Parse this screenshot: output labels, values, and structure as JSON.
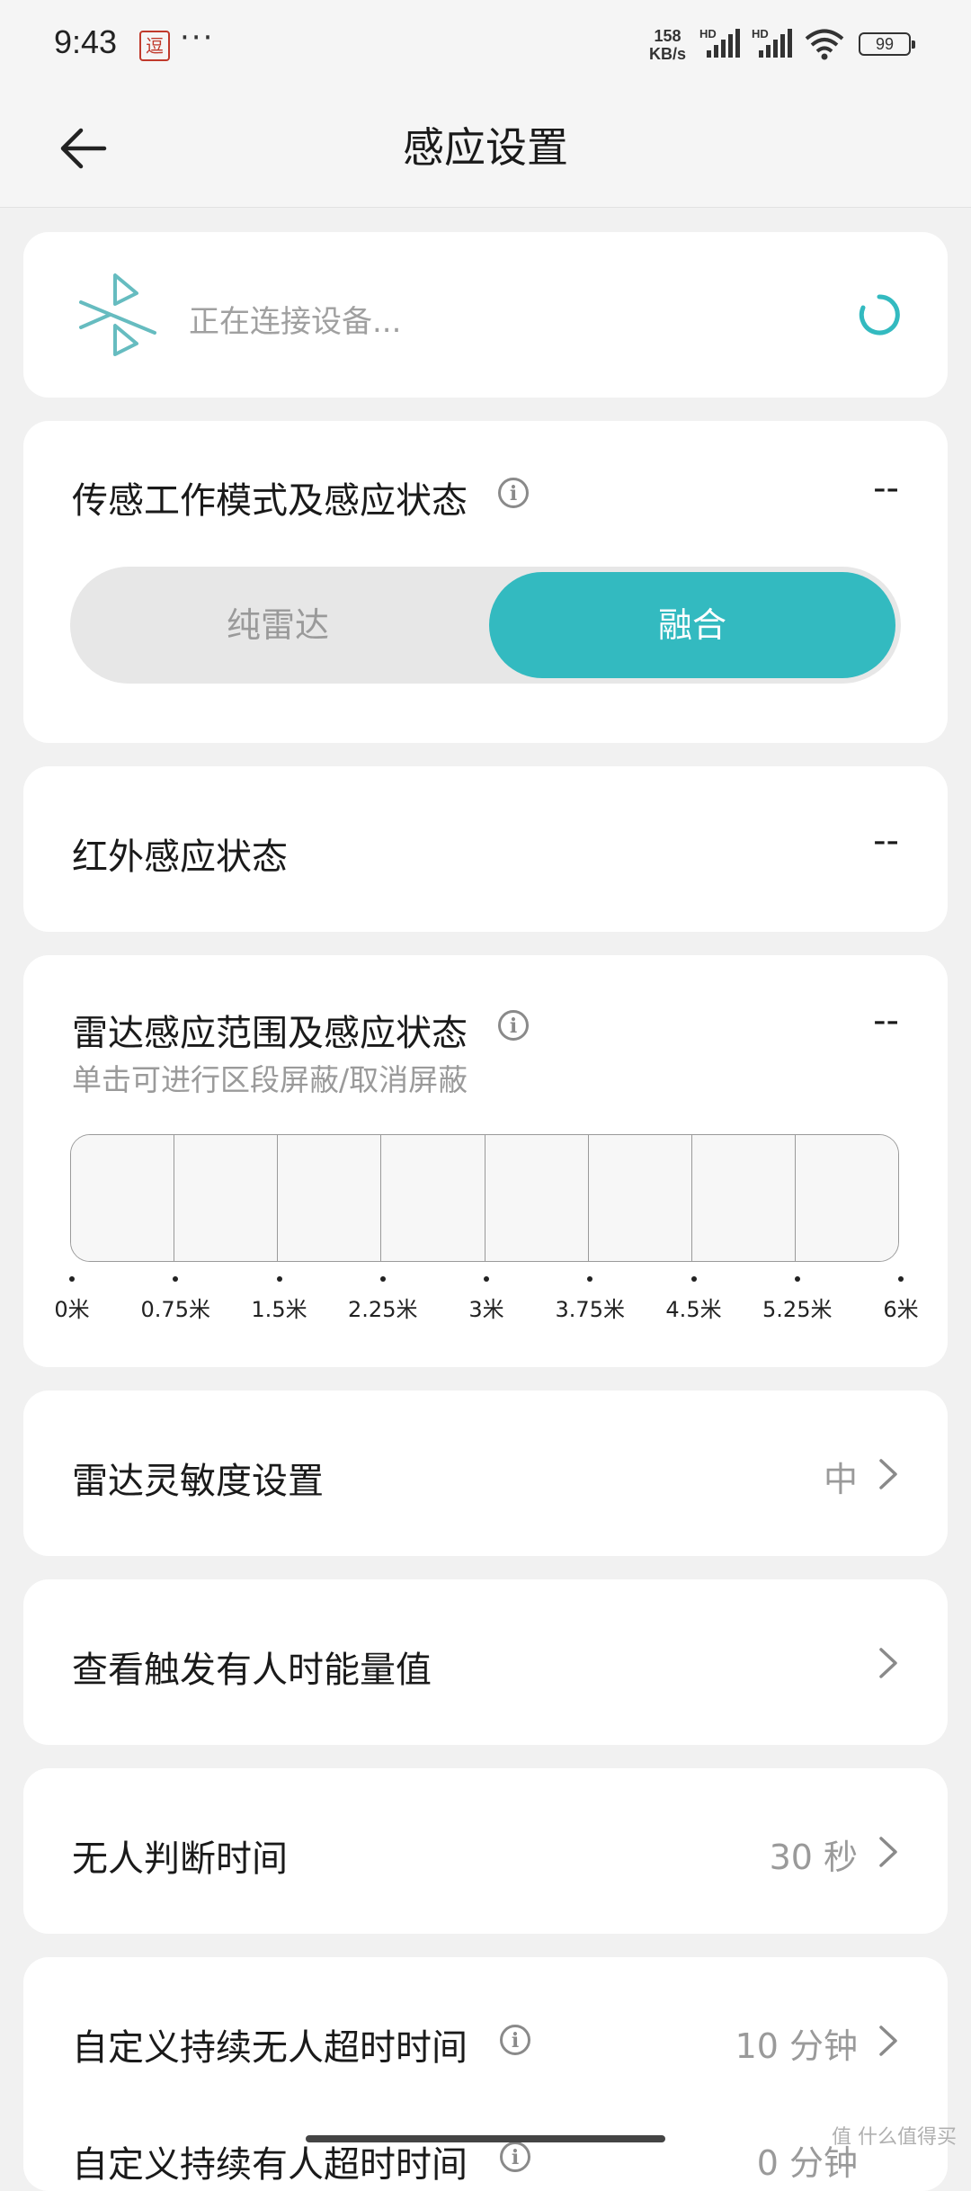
{
  "status_bar": {
    "time": "9:43",
    "app_badge": "逗",
    "more": "···",
    "speed_value": "158",
    "speed_unit": "KB/s",
    "sim1_label": "HD",
    "sim2_label": "HD",
    "battery": "99"
  },
  "header": {
    "title": "感应设置"
  },
  "connection": {
    "status_text": "正在连接设备..."
  },
  "sensor_mode": {
    "label": "传感工作模式及感应状态",
    "status": "--",
    "options": [
      "纯雷达",
      "融合"
    ],
    "selected": "融合"
  },
  "infrared": {
    "label": "红外感应状态",
    "status": "--"
  },
  "radar_range": {
    "label": "雷达感应范围及感应状态",
    "status": "--",
    "hint": "单击可进行区段屏蔽/取消屏蔽",
    "ticks": [
      "0米",
      "0.75米",
      "1.5米",
      "2.25米",
      "3米",
      "3.75米",
      "4.5米",
      "5.25米",
      "6米"
    ]
  },
  "sensitivity": {
    "label": "雷达灵敏度设置",
    "value": "中"
  },
  "energy": {
    "label": "查看触发有人时能量值"
  },
  "vacancy_time": {
    "label": "无人判断时间",
    "value": "30 秒"
  },
  "custom_vacant": {
    "label": "自定义持续无人超时时间",
    "value": "10 分钟"
  },
  "custom_occupied": {
    "label": "自定义持续有人超时时间",
    "value": "0 分钟"
  },
  "colors": {
    "accent": "#33bac0",
    "background": "#f1f1f1"
  },
  "watermark": "值 什么值得买"
}
